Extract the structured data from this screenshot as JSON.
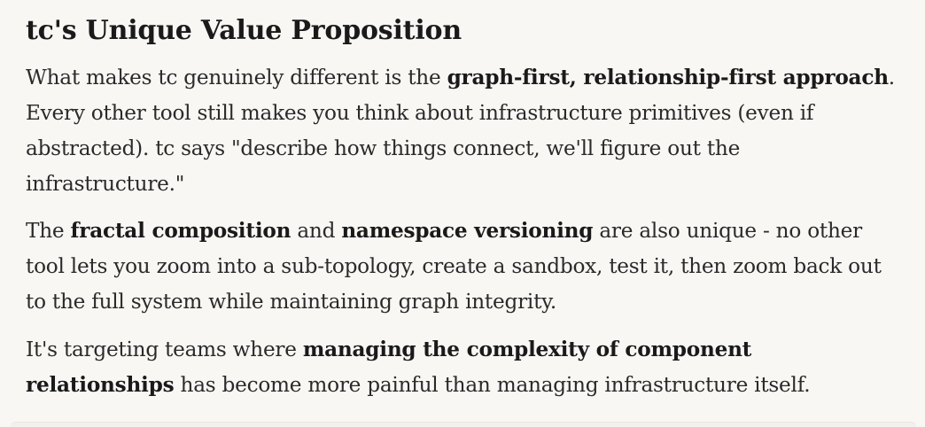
{
  "heading": "tc's Unique Value Proposition",
  "paragraphs": [
    {
      "t1": "What makes tc genuinely different is the ",
      "b1": "graph-first, relationship-first approach",
      "t2": ". Every other tool still makes you think about infrastructure primitives (even if abstracted). tc says \"describe how things connect, we'll figure out the infrastructure.\""
    },
    {
      "t1": "The ",
      "b1": "fractal composition",
      "t2": " and ",
      "b2": "namespace versioning",
      "t3": " are also unique - no other tool lets you zoom into a sub-topology, create a sandbox, test it, then zoom back out to the full system while maintaining graph integrity."
    },
    {
      "t1": "It's targeting teams where ",
      "b1": "managing the complexity of component relationships",
      "t2": " has become more painful than managing infrastructure itself."
    }
  ]
}
